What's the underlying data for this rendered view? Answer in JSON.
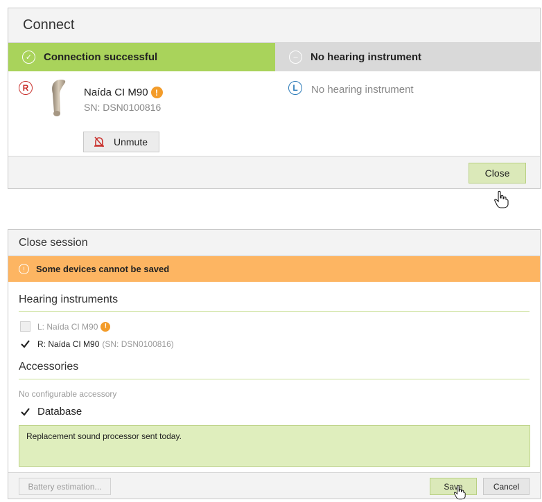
{
  "connect": {
    "title": "Connect",
    "status_left": "Connection successful",
    "status_right": "No hearing instrument",
    "right_side": {
      "side": "R",
      "device_name": "Naída CI M90",
      "serial": "SN: DSN0100816",
      "unmute_label": "Unmute"
    },
    "left_side": {
      "side": "L",
      "empty_text": "No hearing instrument"
    },
    "close_label": "Close"
  },
  "session": {
    "title": "Close session",
    "warning": "Some devices cannot be saved",
    "hearing_header": "Hearing instruments",
    "left_device": {
      "label": "L: Naída CI M90",
      "checked": false
    },
    "right_device": {
      "label": "R: Naída CI M90",
      "serial": "(SN: DSN0100816)",
      "checked": true
    },
    "accessories_header": "Accessories",
    "accessories_empty": "No configurable accessory",
    "database_label": "Database",
    "notes_text": "Replacement sound processor sent today.",
    "battery_label": "Battery estimation...",
    "save_label": "Save",
    "cancel_label": "Cancel"
  },
  "colors": {
    "success_green": "#a9d35b",
    "warning_orange": "#fdb562",
    "button_green": "#dbe9b9",
    "right_red": "#c9302c",
    "left_blue": "#2a7ab8"
  },
  "icons": [
    "check-circle-icon",
    "minus-circle-icon",
    "right-side-icon",
    "left-side-icon",
    "hearing-instrument-icon",
    "warning-icon",
    "mute-icon",
    "checkmark-icon",
    "hand-cursor-icon"
  ]
}
